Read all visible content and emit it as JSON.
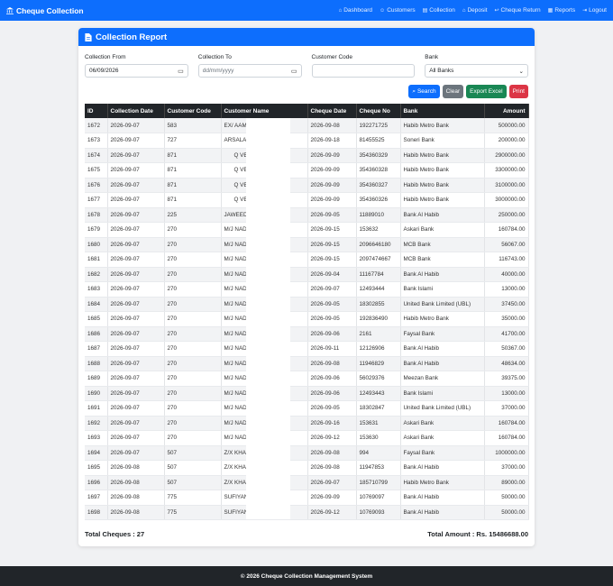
{
  "navbar": {
    "brand": "Cheque Collection",
    "links": [
      {
        "label": "Dashboard",
        "icon": "home-icon"
      },
      {
        "label": "Customers",
        "icon": "users-icon"
      },
      {
        "label": "Collection",
        "icon": "collection-icon"
      },
      {
        "label": "Deposit",
        "icon": "bank-icon"
      },
      {
        "label": "Cheque Return",
        "icon": "return-icon"
      },
      {
        "label": "Reports",
        "icon": "reports-icon"
      },
      {
        "label": "Logout",
        "icon": "logout-icon"
      }
    ]
  },
  "report": {
    "title": "Collection Report",
    "filters": {
      "from_label": "Collection From",
      "from_value": "06/09/2026",
      "to_label": "Collection To",
      "to_placeholder": "dd/mm/yyyy",
      "customer_label": "Customer Code",
      "customer_value": "",
      "bank_label": "Bank",
      "bank_value": "All Banks"
    },
    "buttons": {
      "search": "Search",
      "clear": "Clear",
      "export": "Export Excel",
      "print": "Print"
    },
    "columns": [
      "ID",
      "Collection Date",
      "Customer Code",
      "Customer Name",
      "Cheque Date",
      "Cheque No",
      "Bank",
      "Amount"
    ],
    "rows": [
      [
        "1672",
        "2026-09-07",
        "583",
        "EX/ AAM",
        "2026-09-08",
        "192271725",
        "Habib Metro Bank",
        "500000.00"
      ],
      [
        "1673",
        "2026-09-07",
        "727",
        "ARSALAN",
        "2026-09-18",
        "81455525",
        "Soneri Bank",
        "200000.00"
      ],
      [
        "1674",
        "2026-09-07",
        "871",
        "Q VEN",
        "2026-09-09",
        "354360329",
        "Habib Metro Bank",
        "2900000.00"
      ],
      [
        "1675",
        "2026-09-07",
        "871",
        "Q VEN",
        "2026-09-09",
        "354360328",
        "Habib Metro Bank",
        "3300000.00"
      ],
      [
        "1676",
        "2026-09-07",
        "871",
        "Q VEN",
        "2026-09-09",
        "354360327",
        "Habib Metro Bank",
        "3100000.00"
      ],
      [
        "1677",
        "2026-09-07",
        "871",
        "Q VEN",
        "2026-09-09",
        "354360326",
        "Habib Metro Bank",
        "3000000.00"
      ],
      [
        "1678",
        "2026-09-07",
        "225",
        "JAWEED",
        "2026-09-05",
        "11889010",
        "Bank Al Habib",
        "250000.00"
      ],
      [
        "1679",
        "2026-09-07",
        "270",
        "M/J NAD",
        "2026-09-15",
        "153632",
        "Askari Bank",
        "160784.00"
      ],
      [
        "1680",
        "2026-09-07",
        "270",
        "M/J NAD",
        "2026-09-15",
        "2096646180",
        "MCB Bank",
        "56067.00"
      ],
      [
        "1681",
        "2026-09-07",
        "270",
        "M/J NAD",
        "2026-09-15",
        "2097474667",
        "MCB Bank",
        "116743.00"
      ],
      [
        "1682",
        "2026-09-07",
        "270",
        "M/J NAD",
        "2026-09-04",
        "11167784",
        "Bank Al Habib",
        "40000.00"
      ],
      [
        "1683",
        "2026-09-07",
        "270",
        "M/J NAD",
        "2026-09-07",
        "12493444",
        "Bank Islami",
        "13000.00"
      ],
      [
        "1684",
        "2026-09-07",
        "270",
        "M/J NAD",
        "2026-09-05",
        "18302855",
        "United Bank Limited (UBL)",
        "37450.00"
      ],
      [
        "1685",
        "2026-09-07",
        "270",
        "M/J NAD",
        "2026-09-05",
        "192836490",
        "Habib Metro Bank",
        "35000.00"
      ],
      [
        "1686",
        "2026-09-07",
        "270",
        "M/J NAD",
        "2026-09-06",
        "2161",
        "Faysal Bank",
        "41700.00"
      ],
      [
        "1687",
        "2026-09-07",
        "270",
        "M/J NAD",
        "2026-09-11",
        "12126906",
        "Bank Al Habib",
        "50367.00"
      ],
      [
        "1688",
        "2026-09-07",
        "270",
        "M/J NAD",
        "2026-09-08",
        "11946829",
        "Bank Al Habib",
        "48634.00"
      ],
      [
        "1689",
        "2026-09-07",
        "270",
        "M/J NAD",
        "2026-09-06",
        "56029376",
        "Meezan Bank",
        "39375.00"
      ],
      [
        "1690",
        "2026-09-07",
        "270",
        "M/J NAD",
        "2026-09-06",
        "12493443",
        "Bank Islami",
        "13000.00"
      ],
      [
        "1691",
        "2026-09-07",
        "270",
        "M/J NAD",
        "2026-09-05",
        "18302847",
        "United Bank Limited (UBL)",
        "37000.00"
      ],
      [
        "1692",
        "2026-09-07",
        "270",
        "M/J NAD",
        "2026-09-16",
        "153631",
        "Askari Bank",
        "160784.00"
      ],
      [
        "1693",
        "2026-09-07",
        "270",
        "M/J NAD",
        "2026-09-12",
        "153630",
        "Askari Bank",
        "160784.00"
      ],
      [
        "1694",
        "2026-09-07",
        "507",
        "Z/X KHA",
        "2026-09-08",
        "994",
        "Faysal Bank",
        "1000000.00"
      ],
      [
        "1695",
        "2026-09-08",
        "507",
        "Z/X KHA",
        "2026-09-08",
        "11947853",
        "Bank Al Habib",
        "37000.00"
      ],
      [
        "1696",
        "2026-09-08",
        "507",
        "Z/X KHA",
        "2026-09-07",
        "185710799",
        "Habib Metro Bank",
        "89000.00"
      ],
      [
        "1697",
        "2026-09-08",
        "775",
        "SUFIYAN",
        "2026-09-09",
        "10769097",
        "Bank Al Habib",
        "50000.00"
      ],
      [
        "1698",
        "2026-09-08",
        "775",
        "SUFIYAN",
        "2026-09-12",
        "10769093",
        "Bank Al Habib",
        "50000.00"
      ]
    ],
    "total_cheques": "Total Cheques : 27",
    "total_amount": "Total Amount : Rs. 15486688.00"
  },
  "footer": "© 2026 Cheque Collection Management System",
  "colors": {
    "primary": "#0d6efd",
    "dark": "#212529",
    "success": "#198754",
    "danger": "#dc3545",
    "secondary": "#6c757d"
  }
}
